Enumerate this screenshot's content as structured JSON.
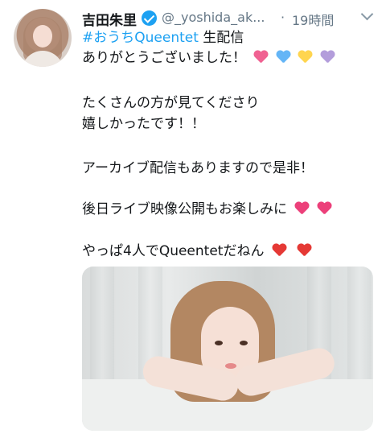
{
  "tweet": {
    "display_name": "吉田朱里",
    "handle": "@_yoshida_ak...",
    "separator": "·",
    "timestamp": "19時間",
    "lines": {
      "l1_hashtag": "#おうちQueentet",
      "l1_rest": " 生配信",
      "l2": "ありがとうございました！",
      "l3": "たくさんの方が見てくださり",
      "l4": "嬉しかったです！！",
      "l5": "アーカイブ配信もありますので是非！",
      "l6": "後日ライブ映像公開もお楽しみに",
      "l7": "やっぱ4人でQueentetだねん"
    },
    "emoji_l2": [
      "pink-heart",
      "blue-heart",
      "yellow-heart",
      "purple-heart"
    ],
    "emoji_l6": [
      "sparkling-heart",
      "sparkling-heart"
    ],
    "emoji_l7": [
      "heart-with-ribbon",
      "heart-with-ribbon"
    ]
  },
  "colors": {
    "link": "#1da1f2",
    "muted": "#657786",
    "verified": "#1da1f2"
  }
}
